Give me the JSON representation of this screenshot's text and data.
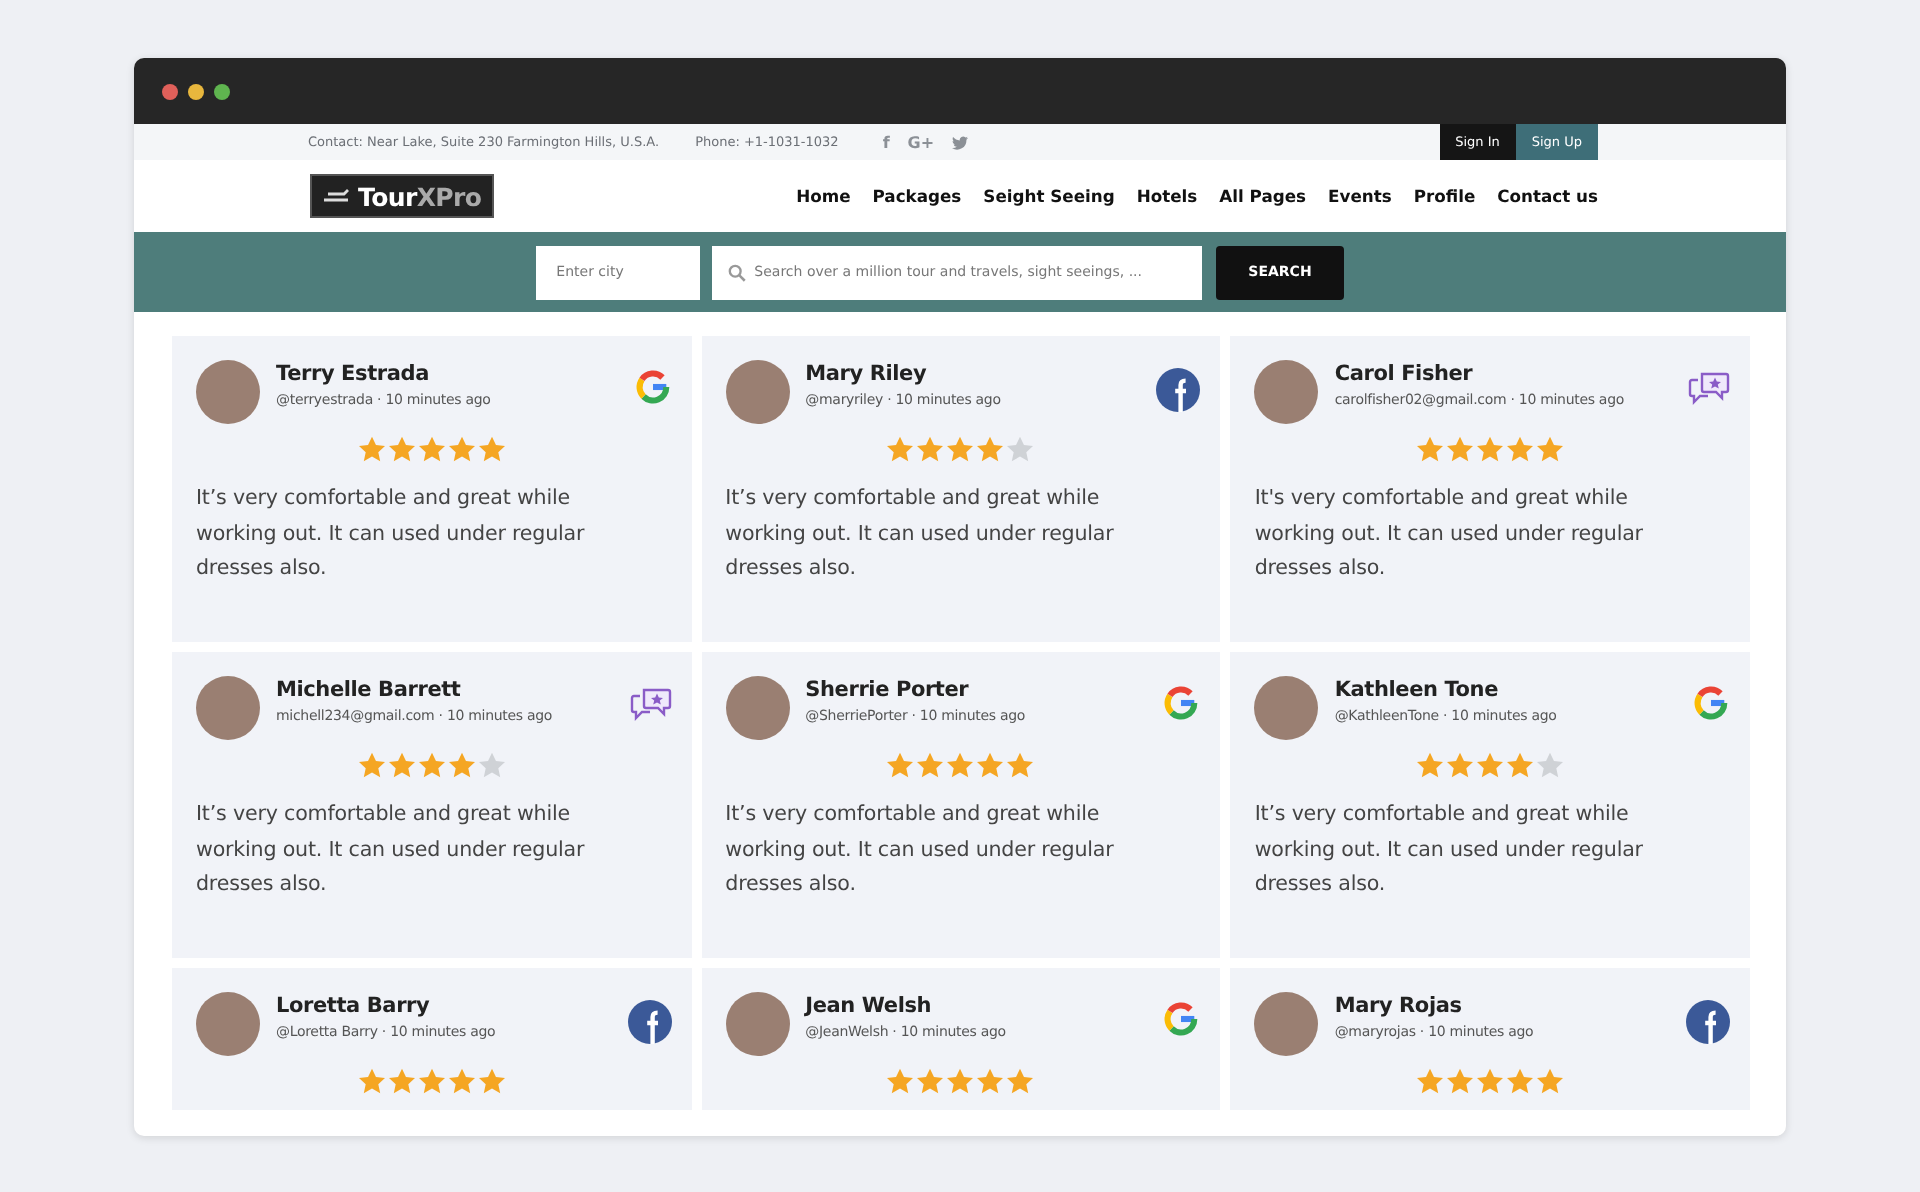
{
  "topbar": {
    "contact": "Contact: Near Lake, Suite 230 Farmington Hills, U.S.A.",
    "phone": "Phone: +1-1031-1032",
    "social": [
      {
        "kind": "facebook",
        "glyph": "f"
      },
      {
        "kind": "google-plus",
        "glyph": "G+"
      },
      {
        "kind": "twitter"
      }
    ],
    "buttons": [
      {
        "label": "Sign In",
        "kind": "dark"
      },
      {
        "label": "Sign Up",
        "kind": "teal"
      }
    ]
  },
  "logo": {
    "primary": "Tour",
    "secondary": "XPro"
  },
  "nav": [
    "Home",
    "Packages",
    "Seight Seeing",
    "Hotels",
    "All Pages",
    "Events",
    "Profile",
    "Contact us"
  ],
  "search": {
    "city_placeholder": "Enter city",
    "query_placeholder": "Search over a million tour and travels, sight seeings, ...",
    "button": "SEARCH"
  },
  "reviews": [
    {
      "name": "Terry Estrada",
      "meta": "@terryestrada · 10 minutes ago",
      "kind": "google",
      "stars": 5,
      "text": "It’s very comfortable and great while working out. It can used under regular dresses also."
    },
    {
      "name": "Mary Riley",
      "meta": "@maryriley · 10 minutes ago",
      "kind": "facebook",
      "stars": 4,
      "text": "It’s very comfortable and great while working out. It can used under regular dresses also."
    },
    {
      "name": "Carol Fisher",
      "meta": "carolfisher02@gmail.com · 10 minutes ago",
      "kind": "review",
      "stars": 5,
      "text": "It's very comfortable and great while working out. It can used under regular dresses also."
    },
    {
      "name": "Michelle Barrett",
      "meta": "michell234@gmail.com · 10 minutes ago",
      "kind": "review",
      "stars": 4,
      "text": "It’s very comfortable and great while working out. It can used under regular dresses also."
    },
    {
      "name": "Sherrie Porter",
      "meta": "@SherriePorter · 10 minutes ago",
      "kind": "google",
      "stars": 5,
      "text": "It’s very comfortable and great while working out. It can used under regular dresses also."
    },
    {
      "name": "Kathleen Tone",
      "meta": "@KathleenTone · 10 minutes ago",
      "kind": "google",
      "stars": 4,
      "text": "It’s very comfortable and great while working out. It can used under regular dresses also."
    },
    {
      "name": "Loretta Barry",
      "meta": "@Loretta Barry · 10 minutes ago",
      "kind": "facebook",
      "stars": 5
    },
    {
      "name": "Jean Welsh",
      "meta": "@JeanWelsh · 10 minutes ago",
      "kind": "google",
      "stars": 5
    },
    {
      "name": "Mary Rojas",
      "meta": "@maryrojas · 10 minutes ago",
      "kind": "facebook",
      "stars": 5
    }
  ]
}
